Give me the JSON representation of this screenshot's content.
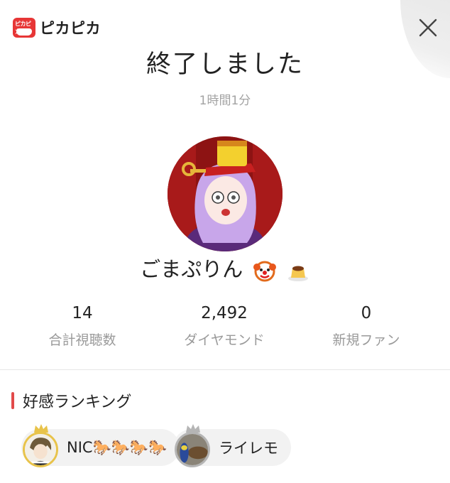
{
  "app": {
    "logo_text": "ピカピカ",
    "logo_badge": "ピカピカ"
  },
  "header": {
    "title": "終了しました",
    "duration": "1時間1分"
  },
  "streamer": {
    "name": "ごまぷりん",
    "emojis": [
      "clown-face-icon",
      "pudding-icon"
    ]
  },
  "stats": [
    {
      "value": "14",
      "label": "合計視聴数"
    },
    {
      "value": "2,492",
      "label": "ダイヤモンド"
    },
    {
      "value": "0",
      "label": "新規ファン"
    }
  ],
  "ranking": {
    "title": "好感ランキング",
    "entries": [
      {
        "name": "NIC🐎🐎🐎🐎",
        "rank_color": "#e8c34a"
      },
      {
        "name": "ライレモ",
        "rank_color": "#b5b5b5"
      }
    ]
  },
  "colors": {
    "accent": "#e24a4a",
    "logo_red": "#e73636",
    "gold": "#e8c34a",
    "silver": "#b5b5b5"
  }
}
